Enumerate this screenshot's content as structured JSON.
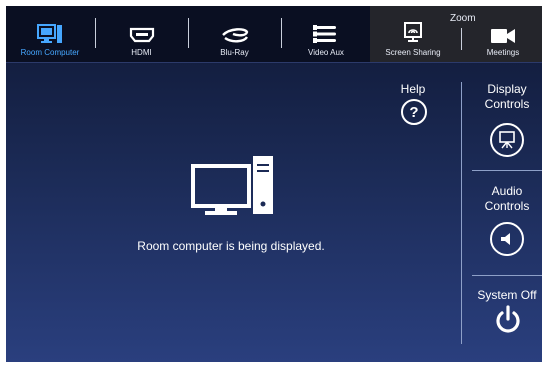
{
  "tabs": [
    {
      "label": "Room Computer",
      "icon": "computer-icon",
      "active": true
    },
    {
      "label": "HDMI",
      "icon": "hdmi-icon",
      "active": false
    },
    {
      "label": "Blu-Ray",
      "icon": "bluray-icon",
      "active": false
    },
    {
      "label": "Video Aux",
      "icon": "video-aux-icon",
      "active": false
    },
    {
      "label": "Screen Sharing",
      "icon": "screen-sharing-icon",
      "active": false
    },
    {
      "label": "Meetings",
      "icon": "meetings-icon",
      "active": false
    }
  ],
  "zoom_group_label": "Zoom",
  "main": {
    "message": "Room computer is being displayed."
  },
  "help": {
    "label": "Help",
    "glyph": "?"
  },
  "side": {
    "display_label": "Display Controls",
    "audio_label": "Audio Controls",
    "system_off_label": "System Off"
  },
  "colors": {
    "accent": "#46a7ff",
    "bar": "#0a0f22",
    "zoom_group": "#24252b"
  }
}
